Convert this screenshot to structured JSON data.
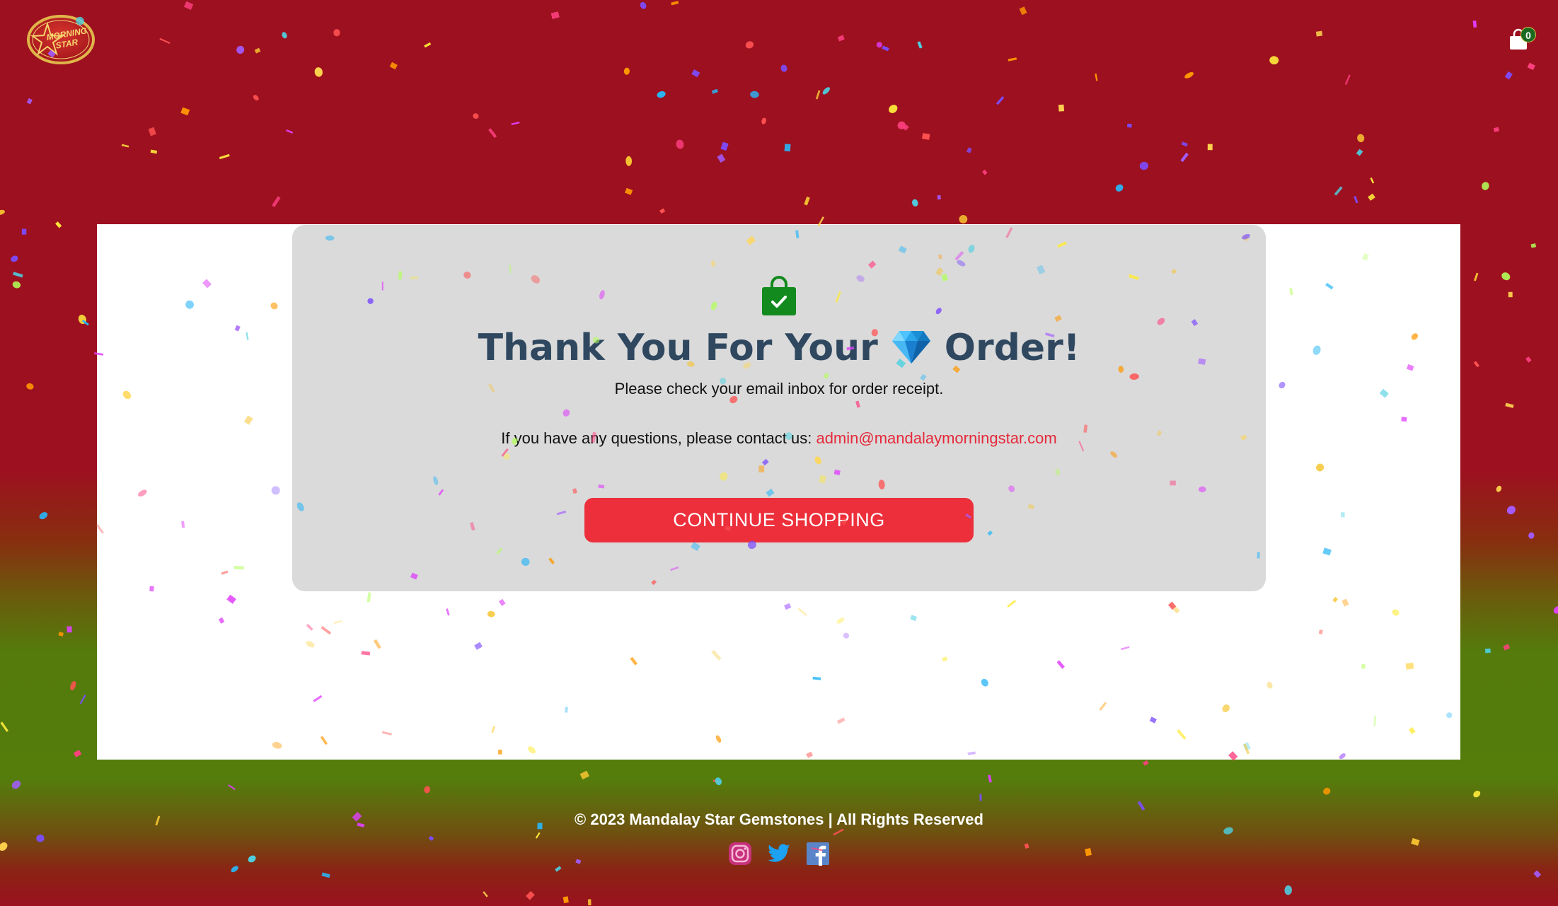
{
  "brand": {
    "logo_line1": "MORNING",
    "logo_line2": "STAR"
  },
  "header": {
    "cart_count": "0"
  },
  "confirmation": {
    "title_before": "Thank You For Your",
    "title_after": "Order!",
    "subtitle": "Please check your email inbox for order receipt.",
    "contact_prefix": "If you have any questions, please contact us:",
    "contact_email": "admin@mandalaymorningstar.com",
    "button_label": "CONTINUE SHOPPING"
  },
  "footer": {
    "copyright": "© 2023 Mandalay Star Gemstones | All Rights Reserved",
    "social": [
      "instagram-icon",
      "twitter-icon",
      "facebook-icon"
    ]
  },
  "colors": {
    "background_red": "#9d101f",
    "background_green": "#547d0c",
    "accent_red": "#ec2f3b",
    "title_navy": "#2f4860",
    "success_green": "#128a1e"
  }
}
